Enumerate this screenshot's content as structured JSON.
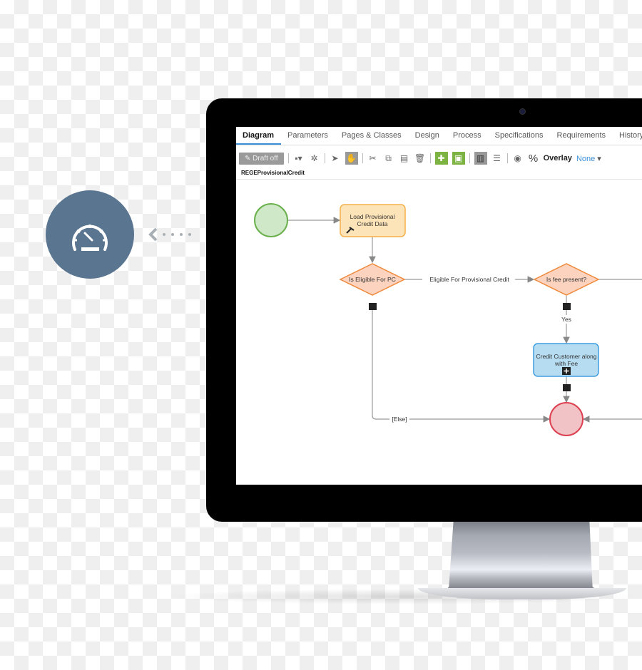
{
  "tabs": [
    "Diagram",
    "Parameters",
    "Pages & Classes",
    "Design",
    "Process",
    "Specifications",
    "Requirements",
    "History"
  ],
  "toolbar": {
    "draft_label": "Draft off",
    "overlay_label": "Overlay",
    "overlay_value": "None"
  },
  "breadcrumb": "REGEProvisionalCredit",
  "diagram": {
    "task_load": [
      "Load Provisional",
      "Credit Data"
    ],
    "decision1": "Is Eligible For PC",
    "connector1": "Eligible For Provisional Credit",
    "decision2": "Is fee present?",
    "connector_yes": "Yes",
    "task_credit": [
      "Credit Customer along",
      "with Fee"
    ],
    "connector_else": "[Else]"
  },
  "colors": {
    "badge": "#5a7590",
    "accent": "#3a8fd8",
    "start": "#cfe8c8",
    "end": "#f2c3c6",
    "task": "#fde3b8",
    "decision": "#fbd3bf",
    "subprocess": "#b6dcf1"
  },
  "icons": {
    "badge": "speedometer-icon",
    "arrow": "chevron-left-icon"
  }
}
